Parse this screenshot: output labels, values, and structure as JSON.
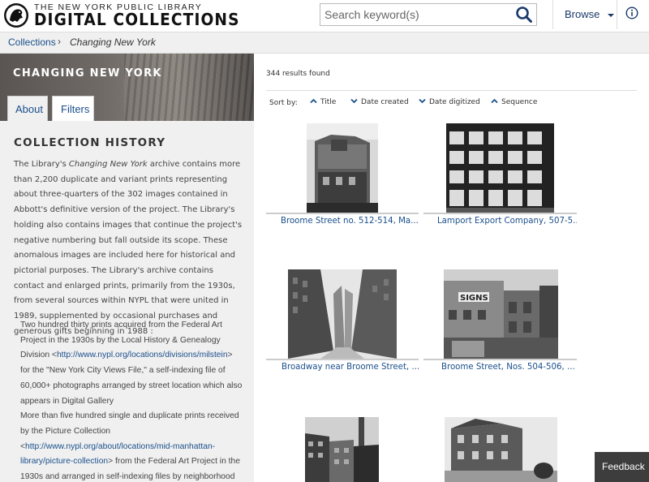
{
  "header": {
    "brand_top": "THE NEW YORK PUBLIC LIBRARY",
    "brand_main": "DIGITAL COLLECTIONS",
    "search_placeholder": "Search keyword(s)",
    "browse_label": "Browse",
    "icons": {
      "logo": "nypl-lion-logo",
      "search": "search-icon",
      "caret": "caret-down-icon",
      "info": "info-icon"
    }
  },
  "breadcrumb": {
    "root": "Collections",
    "separator": "›",
    "current": "Changing New York"
  },
  "sidebar": {
    "collection_title": "CHANGING NEW YORK",
    "tabs": [
      {
        "label": "About",
        "active": true
      },
      {
        "label": "Filters",
        "active": false
      }
    ],
    "section_title": "COLLECTION HISTORY",
    "history_pre": "The Library's ",
    "history_em": "Changing New York",
    "history_post": " archive contains more than 2,200 duplicate and variant prints representing about three-quarters of the 302 images contained in Abbott's definitive version of the project. The Library's holding also contains images that continue the project's negative numbering but fall outside its scope. These anomalous images are included here for historical and pictorial purposes. The Library's archive contains contact and enlarged prints, primarily from the 1930s, from several sources within NYPL that were united in 1989, supplemented by occasional purchases and generous gifts beginning in 1988 :",
    "source1_pre": "Two hundred thirty prints acquired from the Federal Art Project in the 1930s by the Local History & Genealogy Division <",
    "source1_link": "http://www.nypl.org/locations/divisions/milstein",
    "source1_post": "> for the \"New York City Views File,\" a self-indexing file of 60,000+ photographs arranged by street location which also appears in Digital Gallery",
    "source2_pre": "More than five hundred single and duplicate prints received by the Picture Collection <",
    "source2_link": "http://www.nypl.org/about/locations/mid-manhattan-library/picture-collection",
    "source2_post": "> from the Federal Art Project in the 1930s and arranged in self-indexing files by neighborhood and subject"
  },
  "results": {
    "count": "344 results found",
    "sort_label": "Sort by:",
    "sort_options": [
      {
        "label": "Title",
        "direction": "up"
      },
      {
        "label": "Date created",
        "direction": "down"
      },
      {
        "label": "Date digitized",
        "direction": "down"
      },
      {
        "label": "Sequence",
        "direction": "up"
      }
    ],
    "items": [
      {
        "title": "Broome Street no. 512-514, Ma..."
      },
      {
        "title": "Lamport Export Company, 507-5..."
      },
      {
        "title": "Broadway near Broome Street, ..."
      },
      {
        "title": "Broome Street, Nos. 504-506, ..."
      },
      {
        "title": ""
      },
      {
        "title": ""
      }
    ]
  },
  "feedback_label": "Feedback",
  "colors": {
    "link": "#1a4f8b",
    "sidebar_bg": "#f0f0f0",
    "feedback_bg": "#3d3d3d"
  }
}
